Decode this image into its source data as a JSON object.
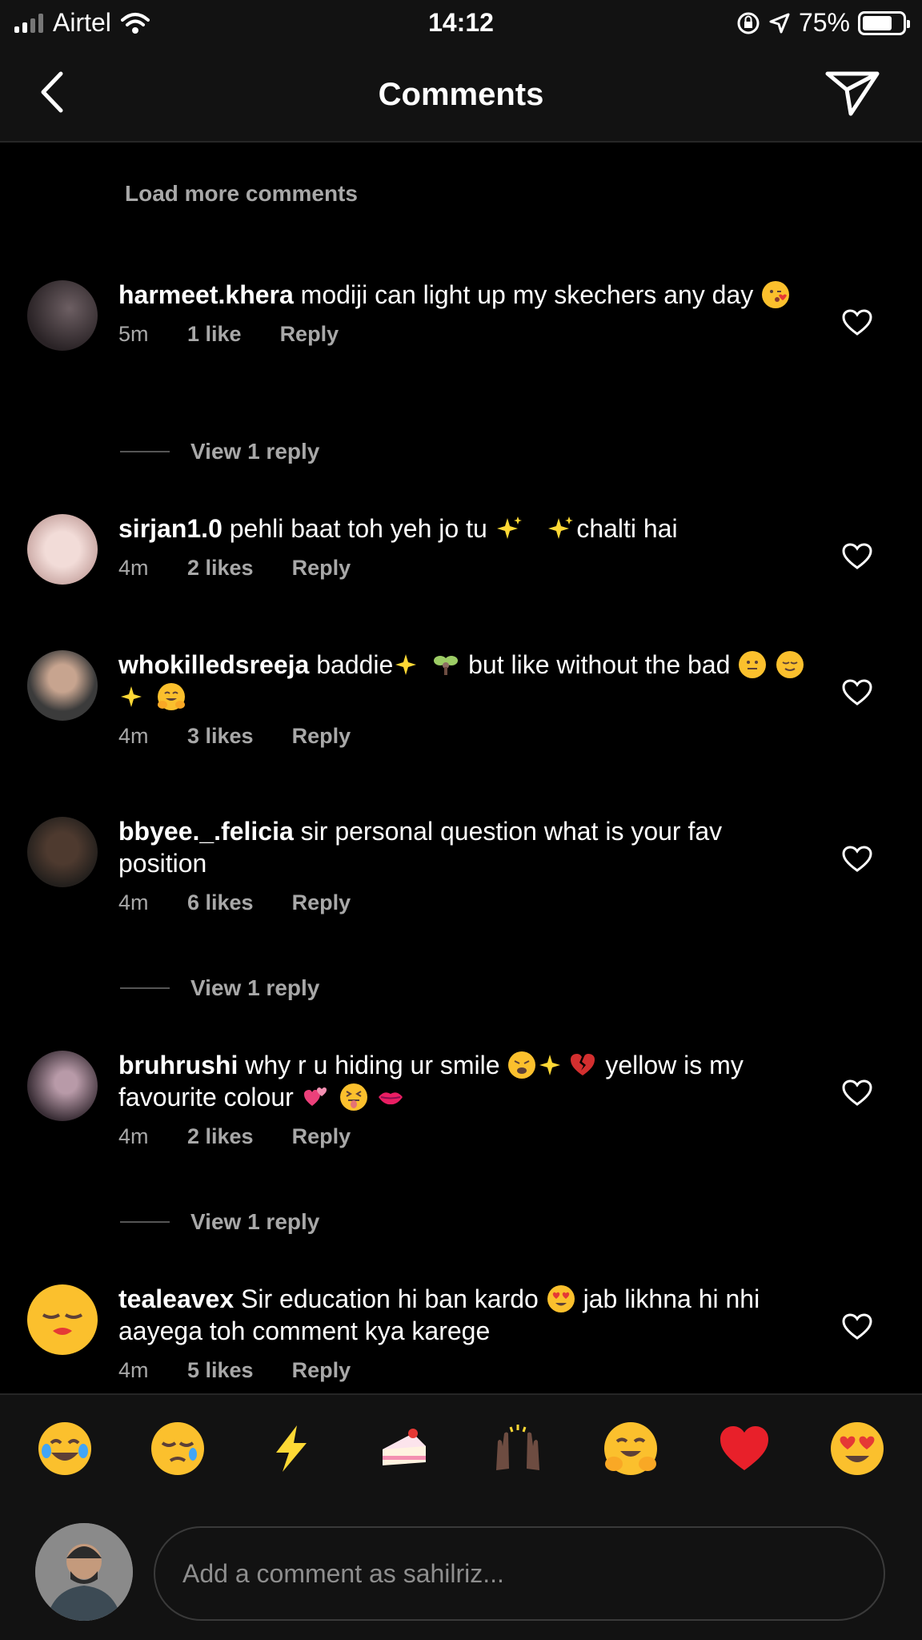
{
  "status": {
    "carrier": "Airtel",
    "time": "14:12",
    "battery": "75%",
    "battery_level": 0.75
  },
  "header": {
    "title": "Comments"
  },
  "feed": {
    "load_more": "Load more comments",
    "comments": [
      {
        "user": "harmeet.khera",
        "text": "modiji can light up my skechers any day",
        "time": "5m",
        "likes": "1 like",
        "reply": "Reply",
        "view_replies": "View 1 reply"
      },
      {
        "user": "sirjan1.0",
        "text_a": "pehli baat toh yeh jo tu",
        "text_b": "chalti hai",
        "time": "4m",
        "likes": "2 likes",
        "reply": "Reply"
      },
      {
        "user": "whokilledsreeja",
        "text_a": "baddie",
        "text_b": "but like without the bad",
        "time": "4m",
        "likes": "3 likes",
        "reply": "Reply"
      },
      {
        "user": "bbyee._.felicia",
        "text": "sir personal question what is your fav position",
        "time": "4m",
        "likes": "6 likes",
        "reply": "Reply",
        "view_replies": "View 1 reply"
      },
      {
        "user": "bruhrushi",
        "text_a": "why r u hiding ur smile",
        "text_b": "yellow is my favourite colour",
        "time": "4m",
        "likes": "2 likes",
        "reply": "Reply",
        "view_replies": "View 1 reply"
      },
      {
        "user": "tealeavex",
        "text_a": "Sir education hi ban kardo",
        "text_b": "jab likhna hi nhi aayega toh comment kya karege",
        "time": "4m",
        "likes": "5 likes",
        "reply": "Reply"
      }
    ]
  },
  "composer": {
    "placeholder": "Add a comment as sahilriz...",
    "emoji_bar": [
      "joy-emoji",
      "sad-tear-emoji",
      "lightning-emoji",
      "cake-emoji",
      "raised-hands-emoji",
      "hug-emoji",
      "red-heart-emoji",
      "heart-eyes-emoji"
    ]
  },
  "colors": {
    "background": "#000000",
    "bar": "#121212",
    "secondary_text": "#a8a8a8",
    "heart_red": "#e8202a",
    "emoji_yellow": "#fbc02d"
  }
}
